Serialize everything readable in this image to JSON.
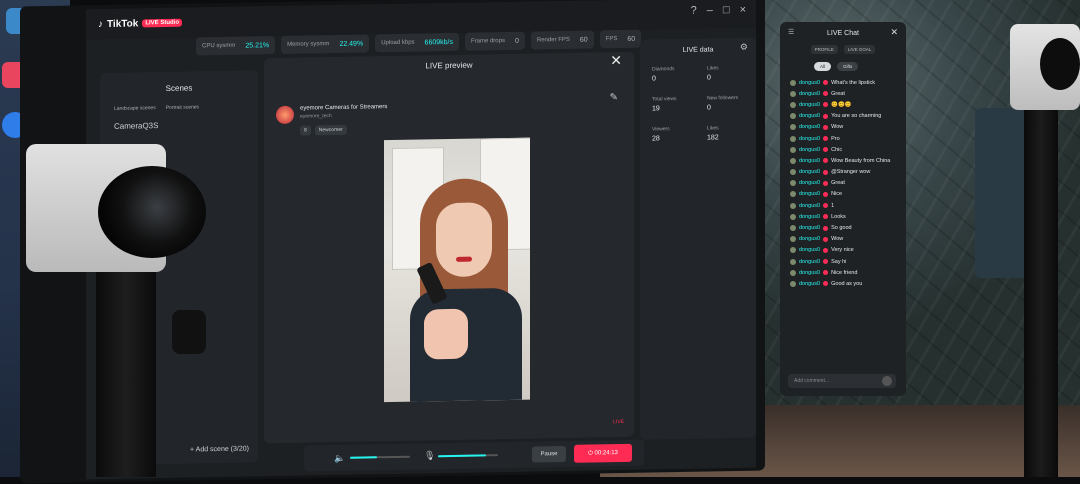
{
  "app": {
    "name": "TikTok",
    "badge": "LIVE Studio"
  },
  "window": {
    "help_icon": "?",
    "minimize": "–",
    "maximize": "□",
    "close": "×"
  },
  "stats": [
    {
      "label": "CPU sysmm",
      "value": "25.21%"
    },
    {
      "label": "Memory sysmm",
      "value": "22.49%"
    },
    {
      "label": "Upload kbps",
      "value": "6609kb/s"
    },
    {
      "label": "Frame drops",
      "value": "0"
    },
    {
      "label": "Render FPS",
      "value": "60"
    },
    {
      "label": "FPS",
      "value": "60"
    }
  ],
  "scenes": {
    "title": "Scenes",
    "tabs": [
      "Landscape scenes",
      "Portrait scenes"
    ],
    "items": [
      "CameraQ3S"
    ],
    "add_label": "Add scene (3/20)"
  },
  "preview": {
    "title": "LIVE preview",
    "host_name": "eyemore Cameras for Streamers",
    "host_handle": "eyemore_tech",
    "chips": [
      "8",
      "Newcomer"
    ],
    "live_tag": "LIVE"
  },
  "controls": {
    "pause": "Pause",
    "stop": "00:24:13",
    "volume_level": 0.45,
    "mic_level": 0.8
  },
  "live_data": {
    "title": "LIVE data",
    "metrics": [
      {
        "label": "Diamonds",
        "value": "0"
      },
      {
        "label": "Likes",
        "value": "0"
      },
      {
        "label": "Total views",
        "value": "19"
      },
      {
        "label": "New followers",
        "value": "0"
      },
      {
        "label": "Viewers",
        "value": "28"
      },
      {
        "label": "Likes",
        "value": "182"
      }
    ]
  },
  "chat": {
    "title": "LIVE Chat",
    "tabs": [
      "PROFILE",
      "LIVE GOAL"
    ],
    "filters": [
      "All",
      "Gifts"
    ],
    "messages": [
      {
        "user": "dongus0",
        "text": "What's the lipstick"
      },
      {
        "user": "dongus0",
        "text": "Great"
      },
      {
        "user": "dongus0",
        "text": "😊😊😊"
      },
      {
        "user": "dongus0",
        "text": "You are so charming"
      },
      {
        "user": "dongus0",
        "text": "Wow"
      },
      {
        "user": "dongus0",
        "text": "Pro"
      },
      {
        "user": "dongus0",
        "text": "Chic"
      },
      {
        "user": "dongus0",
        "text": "Wow Beauty from China"
      },
      {
        "user": "dongus0",
        "text": "@Stranger wow"
      },
      {
        "user": "dongus0",
        "text": "Great"
      },
      {
        "user": "dongus0",
        "text": "Nice"
      },
      {
        "user": "dongus0",
        "text": "1"
      },
      {
        "user": "dongus0",
        "text": "Looks"
      },
      {
        "user": "dongus0",
        "text": "So good"
      },
      {
        "user": "dongus0",
        "text": "Wow"
      },
      {
        "user": "dongus0",
        "text": "Very nice"
      },
      {
        "user": "dongus0",
        "text": "Say hi"
      },
      {
        "user": "dongus0",
        "text": "Nice friend"
      },
      {
        "user": "dongus0",
        "text": "Good as you"
      }
    ],
    "input_placeholder": "Add comment..."
  }
}
